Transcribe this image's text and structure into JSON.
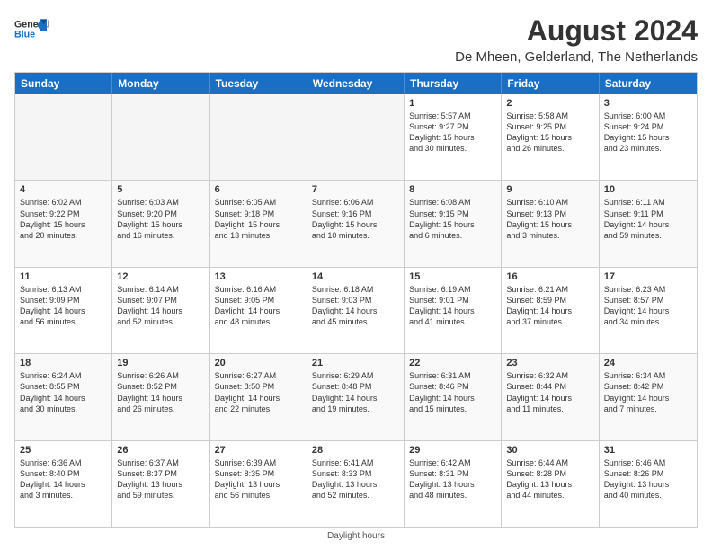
{
  "header": {
    "logo_line1": "General",
    "logo_line2": "Blue",
    "month_year": "August 2024",
    "location": "De Mheen, Gelderland, The Netherlands"
  },
  "days": [
    "Sunday",
    "Monday",
    "Tuesday",
    "Wednesday",
    "Thursday",
    "Friday",
    "Saturday"
  ],
  "weeks": [
    [
      {
        "day": "",
        "text": ""
      },
      {
        "day": "",
        "text": ""
      },
      {
        "day": "",
        "text": ""
      },
      {
        "day": "",
        "text": ""
      },
      {
        "day": "1",
        "text": "Sunrise: 5:57 AM\nSunset: 9:27 PM\nDaylight: 15 hours\nand 30 minutes."
      },
      {
        "day": "2",
        "text": "Sunrise: 5:58 AM\nSunset: 9:25 PM\nDaylight: 15 hours\nand 26 minutes."
      },
      {
        "day": "3",
        "text": "Sunrise: 6:00 AM\nSunset: 9:24 PM\nDaylight: 15 hours\nand 23 minutes."
      }
    ],
    [
      {
        "day": "4",
        "text": "Sunrise: 6:02 AM\nSunset: 9:22 PM\nDaylight: 15 hours\nand 20 minutes."
      },
      {
        "day": "5",
        "text": "Sunrise: 6:03 AM\nSunset: 9:20 PM\nDaylight: 15 hours\nand 16 minutes."
      },
      {
        "day": "6",
        "text": "Sunrise: 6:05 AM\nSunset: 9:18 PM\nDaylight: 15 hours\nand 13 minutes."
      },
      {
        "day": "7",
        "text": "Sunrise: 6:06 AM\nSunset: 9:16 PM\nDaylight: 15 hours\nand 10 minutes."
      },
      {
        "day": "8",
        "text": "Sunrise: 6:08 AM\nSunset: 9:15 PM\nDaylight: 15 hours\nand 6 minutes."
      },
      {
        "day": "9",
        "text": "Sunrise: 6:10 AM\nSunset: 9:13 PM\nDaylight: 15 hours\nand 3 minutes."
      },
      {
        "day": "10",
        "text": "Sunrise: 6:11 AM\nSunset: 9:11 PM\nDaylight: 14 hours\nand 59 minutes."
      }
    ],
    [
      {
        "day": "11",
        "text": "Sunrise: 6:13 AM\nSunset: 9:09 PM\nDaylight: 14 hours\nand 56 minutes."
      },
      {
        "day": "12",
        "text": "Sunrise: 6:14 AM\nSunset: 9:07 PM\nDaylight: 14 hours\nand 52 minutes."
      },
      {
        "day": "13",
        "text": "Sunrise: 6:16 AM\nSunset: 9:05 PM\nDaylight: 14 hours\nand 48 minutes."
      },
      {
        "day": "14",
        "text": "Sunrise: 6:18 AM\nSunset: 9:03 PM\nDaylight: 14 hours\nand 45 minutes."
      },
      {
        "day": "15",
        "text": "Sunrise: 6:19 AM\nSunset: 9:01 PM\nDaylight: 14 hours\nand 41 minutes."
      },
      {
        "day": "16",
        "text": "Sunrise: 6:21 AM\nSunset: 8:59 PM\nDaylight: 14 hours\nand 37 minutes."
      },
      {
        "day": "17",
        "text": "Sunrise: 6:23 AM\nSunset: 8:57 PM\nDaylight: 14 hours\nand 34 minutes."
      }
    ],
    [
      {
        "day": "18",
        "text": "Sunrise: 6:24 AM\nSunset: 8:55 PM\nDaylight: 14 hours\nand 30 minutes."
      },
      {
        "day": "19",
        "text": "Sunrise: 6:26 AM\nSunset: 8:52 PM\nDaylight: 14 hours\nand 26 minutes."
      },
      {
        "day": "20",
        "text": "Sunrise: 6:27 AM\nSunset: 8:50 PM\nDaylight: 14 hours\nand 22 minutes."
      },
      {
        "day": "21",
        "text": "Sunrise: 6:29 AM\nSunset: 8:48 PM\nDaylight: 14 hours\nand 19 minutes."
      },
      {
        "day": "22",
        "text": "Sunrise: 6:31 AM\nSunset: 8:46 PM\nDaylight: 14 hours\nand 15 minutes."
      },
      {
        "day": "23",
        "text": "Sunrise: 6:32 AM\nSunset: 8:44 PM\nDaylight: 14 hours\nand 11 minutes."
      },
      {
        "day": "24",
        "text": "Sunrise: 6:34 AM\nSunset: 8:42 PM\nDaylight: 14 hours\nand 7 minutes."
      }
    ],
    [
      {
        "day": "25",
        "text": "Sunrise: 6:36 AM\nSunset: 8:40 PM\nDaylight: 14 hours\nand 3 minutes."
      },
      {
        "day": "26",
        "text": "Sunrise: 6:37 AM\nSunset: 8:37 PM\nDaylight: 13 hours\nand 59 minutes."
      },
      {
        "day": "27",
        "text": "Sunrise: 6:39 AM\nSunset: 8:35 PM\nDaylight: 13 hours\nand 56 minutes."
      },
      {
        "day": "28",
        "text": "Sunrise: 6:41 AM\nSunset: 8:33 PM\nDaylight: 13 hours\nand 52 minutes."
      },
      {
        "day": "29",
        "text": "Sunrise: 6:42 AM\nSunset: 8:31 PM\nDaylight: 13 hours\nand 48 minutes."
      },
      {
        "day": "30",
        "text": "Sunrise: 6:44 AM\nSunset: 8:28 PM\nDaylight: 13 hours\nand 44 minutes."
      },
      {
        "day": "31",
        "text": "Sunrise: 6:46 AM\nSunset: 8:26 PM\nDaylight: 13 hours\nand 40 minutes."
      }
    ]
  ],
  "footer": "Daylight hours"
}
